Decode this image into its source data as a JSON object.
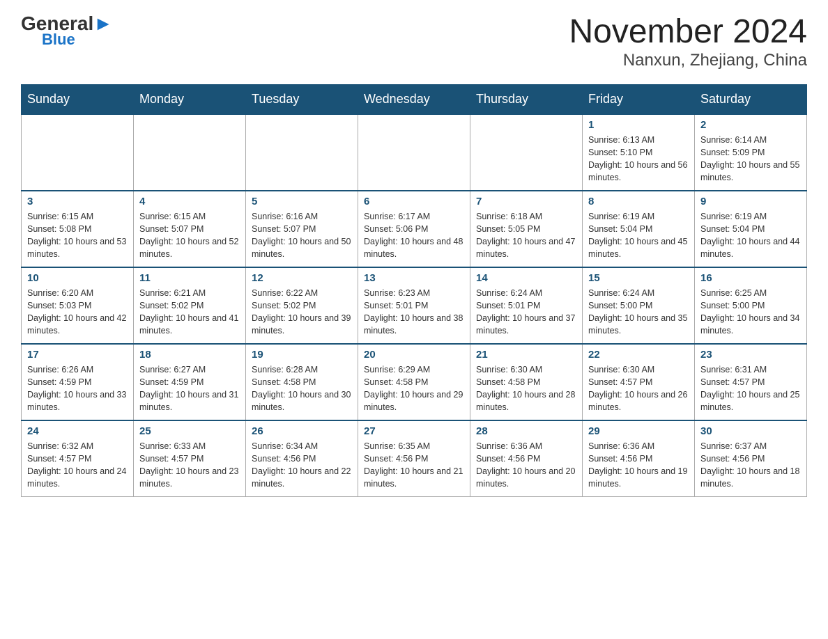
{
  "header": {
    "logo_general": "General",
    "logo_blue": "Blue",
    "title": "November 2024",
    "subtitle": "Nanxun, Zhejiang, China"
  },
  "days_of_week": [
    "Sunday",
    "Monday",
    "Tuesday",
    "Wednesday",
    "Thursday",
    "Friday",
    "Saturday"
  ],
  "weeks": [
    [
      {
        "day": "",
        "info": ""
      },
      {
        "day": "",
        "info": ""
      },
      {
        "day": "",
        "info": ""
      },
      {
        "day": "",
        "info": ""
      },
      {
        "day": "",
        "info": ""
      },
      {
        "day": "1",
        "info": "Sunrise: 6:13 AM\nSunset: 5:10 PM\nDaylight: 10 hours and 56 minutes."
      },
      {
        "day": "2",
        "info": "Sunrise: 6:14 AM\nSunset: 5:09 PM\nDaylight: 10 hours and 55 minutes."
      }
    ],
    [
      {
        "day": "3",
        "info": "Sunrise: 6:15 AM\nSunset: 5:08 PM\nDaylight: 10 hours and 53 minutes."
      },
      {
        "day": "4",
        "info": "Sunrise: 6:15 AM\nSunset: 5:07 PM\nDaylight: 10 hours and 52 minutes."
      },
      {
        "day": "5",
        "info": "Sunrise: 6:16 AM\nSunset: 5:07 PM\nDaylight: 10 hours and 50 minutes."
      },
      {
        "day": "6",
        "info": "Sunrise: 6:17 AM\nSunset: 5:06 PM\nDaylight: 10 hours and 48 minutes."
      },
      {
        "day": "7",
        "info": "Sunrise: 6:18 AM\nSunset: 5:05 PM\nDaylight: 10 hours and 47 minutes."
      },
      {
        "day": "8",
        "info": "Sunrise: 6:19 AM\nSunset: 5:04 PM\nDaylight: 10 hours and 45 minutes."
      },
      {
        "day": "9",
        "info": "Sunrise: 6:19 AM\nSunset: 5:04 PM\nDaylight: 10 hours and 44 minutes."
      }
    ],
    [
      {
        "day": "10",
        "info": "Sunrise: 6:20 AM\nSunset: 5:03 PM\nDaylight: 10 hours and 42 minutes."
      },
      {
        "day": "11",
        "info": "Sunrise: 6:21 AM\nSunset: 5:02 PM\nDaylight: 10 hours and 41 minutes."
      },
      {
        "day": "12",
        "info": "Sunrise: 6:22 AM\nSunset: 5:02 PM\nDaylight: 10 hours and 39 minutes."
      },
      {
        "day": "13",
        "info": "Sunrise: 6:23 AM\nSunset: 5:01 PM\nDaylight: 10 hours and 38 minutes."
      },
      {
        "day": "14",
        "info": "Sunrise: 6:24 AM\nSunset: 5:01 PM\nDaylight: 10 hours and 37 minutes."
      },
      {
        "day": "15",
        "info": "Sunrise: 6:24 AM\nSunset: 5:00 PM\nDaylight: 10 hours and 35 minutes."
      },
      {
        "day": "16",
        "info": "Sunrise: 6:25 AM\nSunset: 5:00 PM\nDaylight: 10 hours and 34 minutes."
      }
    ],
    [
      {
        "day": "17",
        "info": "Sunrise: 6:26 AM\nSunset: 4:59 PM\nDaylight: 10 hours and 33 minutes."
      },
      {
        "day": "18",
        "info": "Sunrise: 6:27 AM\nSunset: 4:59 PM\nDaylight: 10 hours and 31 minutes."
      },
      {
        "day": "19",
        "info": "Sunrise: 6:28 AM\nSunset: 4:58 PM\nDaylight: 10 hours and 30 minutes."
      },
      {
        "day": "20",
        "info": "Sunrise: 6:29 AM\nSunset: 4:58 PM\nDaylight: 10 hours and 29 minutes."
      },
      {
        "day": "21",
        "info": "Sunrise: 6:30 AM\nSunset: 4:58 PM\nDaylight: 10 hours and 28 minutes."
      },
      {
        "day": "22",
        "info": "Sunrise: 6:30 AM\nSunset: 4:57 PM\nDaylight: 10 hours and 26 minutes."
      },
      {
        "day": "23",
        "info": "Sunrise: 6:31 AM\nSunset: 4:57 PM\nDaylight: 10 hours and 25 minutes."
      }
    ],
    [
      {
        "day": "24",
        "info": "Sunrise: 6:32 AM\nSunset: 4:57 PM\nDaylight: 10 hours and 24 minutes."
      },
      {
        "day": "25",
        "info": "Sunrise: 6:33 AM\nSunset: 4:57 PM\nDaylight: 10 hours and 23 minutes."
      },
      {
        "day": "26",
        "info": "Sunrise: 6:34 AM\nSunset: 4:56 PM\nDaylight: 10 hours and 22 minutes."
      },
      {
        "day": "27",
        "info": "Sunrise: 6:35 AM\nSunset: 4:56 PM\nDaylight: 10 hours and 21 minutes."
      },
      {
        "day": "28",
        "info": "Sunrise: 6:36 AM\nSunset: 4:56 PM\nDaylight: 10 hours and 20 minutes."
      },
      {
        "day": "29",
        "info": "Sunrise: 6:36 AM\nSunset: 4:56 PM\nDaylight: 10 hours and 19 minutes."
      },
      {
        "day": "30",
        "info": "Sunrise: 6:37 AM\nSunset: 4:56 PM\nDaylight: 10 hours and 18 minutes."
      }
    ]
  ]
}
